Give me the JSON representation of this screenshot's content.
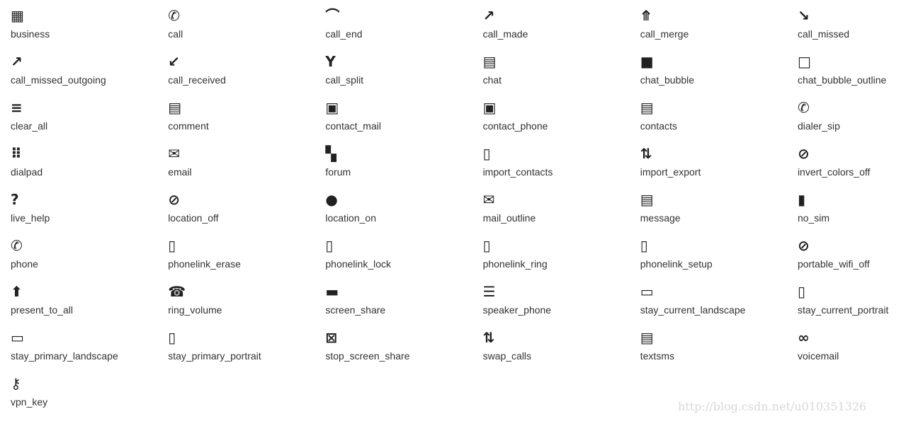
{
  "icons": [
    {
      "name": "business",
      "glyph": "▦"
    },
    {
      "name": "call",
      "glyph": "✆"
    },
    {
      "name": "call_end",
      "glyph": "⌒"
    },
    {
      "name": "call_made",
      "glyph": "↗"
    },
    {
      "name": "call_merge",
      "glyph": "⤊"
    },
    {
      "name": "call_missed",
      "glyph": "↘"
    },
    {
      "name": "call_missed_outgoing",
      "glyph": "↗"
    },
    {
      "name": "call_received",
      "glyph": "↙"
    },
    {
      "name": "call_split",
      "glyph": "Y"
    },
    {
      "name": "chat",
      "glyph": "▤"
    },
    {
      "name": "chat_bubble",
      "glyph": "■"
    },
    {
      "name": "chat_bubble_outline",
      "glyph": "□"
    },
    {
      "name": "clear_all",
      "glyph": "≡"
    },
    {
      "name": "comment",
      "glyph": "▤"
    },
    {
      "name": "contact_mail",
      "glyph": "▣"
    },
    {
      "name": "contact_phone",
      "glyph": "▣"
    },
    {
      "name": "contacts",
      "glyph": "▤"
    },
    {
      "name": "dialer_sip",
      "glyph": "✆"
    },
    {
      "name": "dialpad",
      "glyph": "⠿"
    },
    {
      "name": "email",
      "glyph": "✉"
    },
    {
      "name": "forum",
      "glyph": "▚"
    },
    {
      "name": "import_contacts",
      "glyph": "▯"
    },
    {
      "name": "import_export",
      "glyph": "⇅"
    },
    {
      "name": "invert_colors_off",
      "glyph": "⊘"
    },
    {
      "name": "live_help",
      "glyph": "?"
    },
    {
      "name": "location_off",
      "glyph": "⊘"
    },
    {
      "name": "location_on",
      "glyph": "●"
    },
    {
      "name": "mail_outline",
      "glyph": "✉"
    },
    {
      "name": "message",
      "glyph": "▤"
    },
    {
      "name": "no_sim",
      "glyph": "▮"
    },
    {
      "name": "phone",
      "glyph": "✆"
    },
    {
      "name": "phonelink_erase",
      "glyph": "▯"
    },
    {
      "name": "phonelink_lock",
      "glyph": "▯"
    },
    {
      "name": "phonelink_ring",
      "glyph": "▯"
    },
    {
      "name": "phonelink_setup",
      "glyph": "▯"
    },
    {
      "name": "portable_wifi_off",
      "glyph": "⊘"
    },
    {
      "name": "present_to_all",
      "glyph": "⬆"
    },
    {
      "name": "ring_volume",
      "glyph": "☎"
    },
    {
      "name": "screen_share",
      "glyph": "▬"
    },
    {
      "name": "speaker_phone",
      "glyph": "☰"
    },
    {
      "name": "stay_current_landscape",
      "glyph": "▭"
    },
    {
      "name": "stay_current_portrait",
      "glyph": "▯"
    },
    {
      "name": "stay_primary_landscape",
      "glyph": "▭"
    },
    {
      "name": "stay_primary_portrait",
      "glyph": "▯"
    },
    {
      "name": "stop_screen_share",
      "glyph": "⊠"
    },
    {
      "name": "swap_calls",
      "glyph": "⇅"
    },
    {
      "name": "textsms",
      "glyph": "▤"
    },
    {
      "name": "voicemail",
      "glyph": "∞"
    },
    {
      "name": "vpn_key",
      "glyph": "⚷"
    }
  ],
  "watermark": "http://blog.csdn.net/u010351326"
}
